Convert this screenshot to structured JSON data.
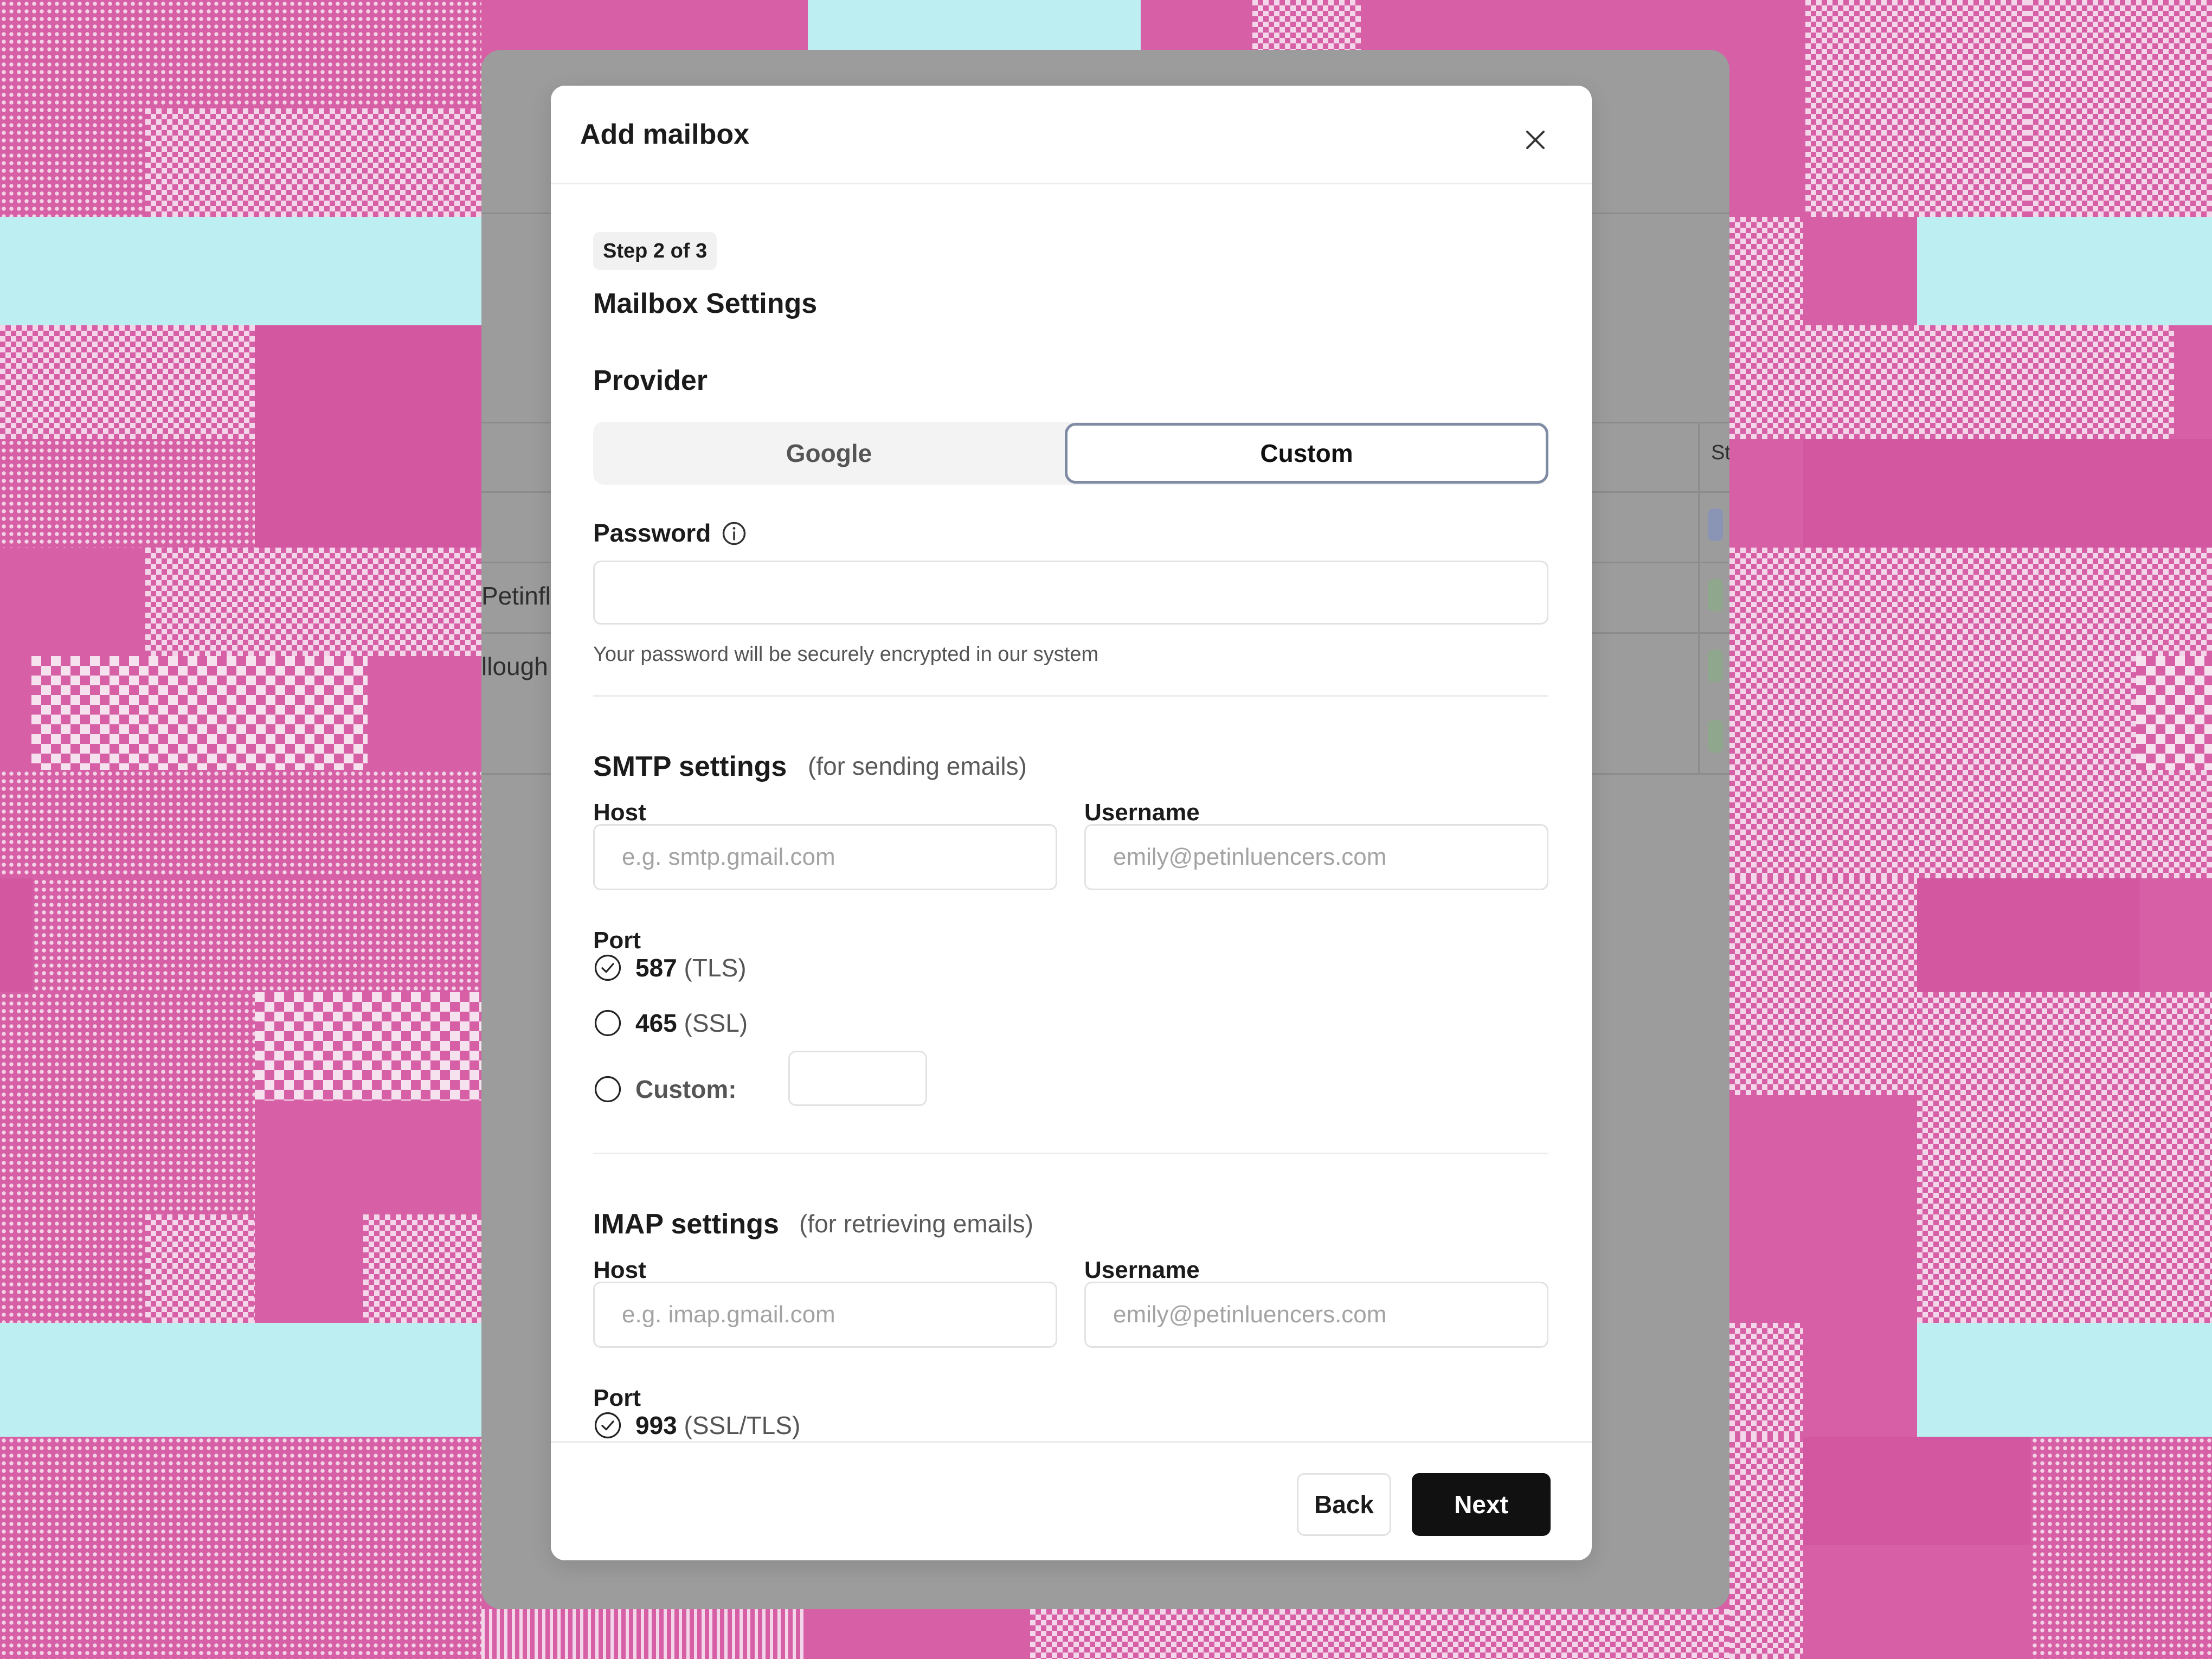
{
  "backdrop": {
    "row_fragments": [
      "Petinfl",
      "llough"
    ],
    "column_fragment": "St"
  },
  "modal": {
    "title": "Add mailbox",
    "step_badge": "Step 2 of 3",
    "section_title": "Mailbox Settings",
    "provider": {
      "label": "Provider",
      "options": [
        "Google",
        "Custom"
      ],
      "selected": "Custom"
    },
    "password": {
      "label": "Password",
      "value": "",
      "helper": "Your password will be securely encrypted in our system"
    },
    "smtp": {
      "title": "SMTP settings",
      "hint": "(for sending emails)",
      "host_label": "Host",
      "host_placeholder": "e.g. smtp.gmail.com",
      "username_label": "Username",
      "username_placeholder": "emily@petinluencers.com",
      "port_label": "Port",
      "ports": [
        {
          "number": "587",
          "protocol": "(TLS)",
          "checked": true
        },
        {
          "number": "465",
          "protocol": "(SSL)",
          "checked": false
        }
      ],
      "custom_label": "Custom:",
      "custom_value": ""
    },
    "imap": {
      "title": "IMAP settings",
      "hint": "(for retrieving emails)",
      "host_label": "Host",
      "host_placeholder": "e.g. imap.gmail.com",
      "username_label": "Username",
      "username_placeholder": "emily@petinluencers.com",
      "port_label": "Port",
      "ports": [
        {
          "number": "993",
          "protocol": "(SSL/TLS)",
          "checked": true
        }
      ]
    },
    "footer": {
      "back_label": "Back",
      "next_label": "Next"
    }
  },
  "colors": {
    "accent_border": "#7e8ba3",
    "primary_button": "#111111",
    "background_pink": "#d65fa6",
    "background_cyan": "#bdeff2"
  },
  "icons": [
    "close-icon",
    "info-icon",
    "radio-checked-icon",
    "radio-empty-icon"
  ]
}
